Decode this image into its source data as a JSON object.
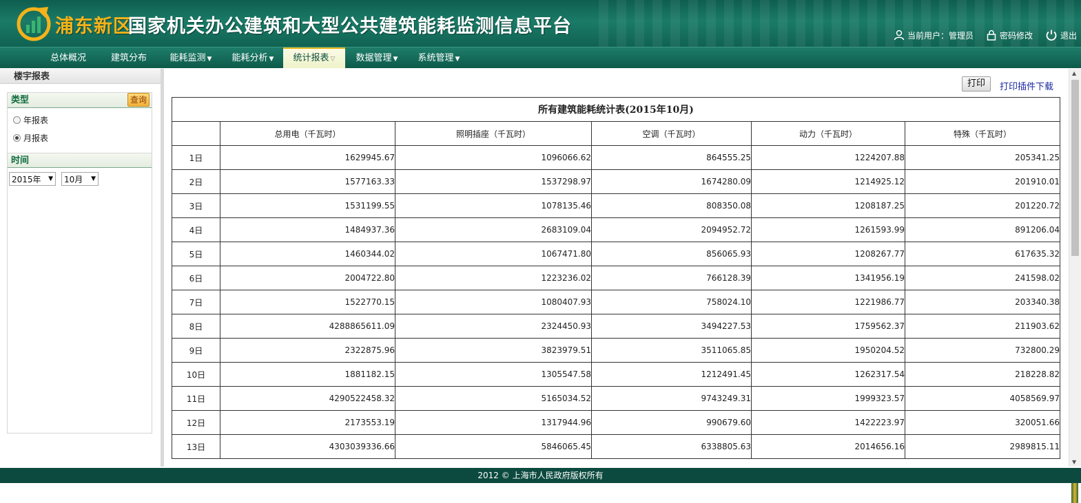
{
  "header": {
    "brand": "浦东新区",
    "title": "国家机关办公建筑和大型公共建筑能耗监测信息平台",
    "current_user_label": "当前用户：管理员",
    "change_password": "密码修改",
    "logout": "退出"
  },
  "nav": [
    {
      "label": "总体概况",
      "dropdown": false
    },
    {
      "label": "建筑分布",
      "dropdown": false
    },
    {
      "label": "能耗监测",
      "dropdown": true
    },
    {
      "label": "能耗分析",
      "dropdown": true
    },
    {
      "label": "统计报表",
      "dropdown": true,
      "active": true
    },
    {
      "label": "数据管理",
      "dropdown": true
    },
    {
      "label": "系统管理",
      "dropdown": true
    }
  ],
  "sidebar": {
    "title": "楼宇报表",
    "type_heading": "类型",
    "query_label": "查询",
    "options": [
      {
        "label": "年报表",
        "selected": false
      },
      {
        "label": "月报表",
        "selected": true
      }
    ],
    "time_heading": "时间",
    "year_value": "2015年",
    "month_value": "10月"
  },
  "content": {
    "print_label": "打印",
    "plugin_link": "打印插件下载",
    "table": {
      "caption": "所有建筑能耗统计表(2015年10月)",
      "columns": [
        "",
        "总用电（千瓦时）",
        "照明插座（千瓦时）",
        "空调（千瓦时）",
        "动力（千瓦时）",
        "特殊（千瓦时）"
      ],
      "rows": [
        [
          "1日",
          "1629945.67",
          "1096066.62",
          "864555.25",
          "1224207.88",
          "205341.25"
        ],
        [
          "2日",
          "1577163.33",
          "1537298.97",
          "1674280.09",
          "1214925.12",
          "201910.01"
        ],
        [
          "3日",
          "1531199.55",
          "1078135.46",
          "808350.08",
          "1208187.25",
          "201220.72"
        ],
        [
          "4日",
          "1484937.36",
          "2683109.04",
          "2094952.72",
          "1261593.99",
          "891206.04"
        ],
        [
          "5日",
          "1460344.02",
          "1067471.80",
          "856065.93",
          "1208267.77",
          "617635.32"
        ],
        [
          "6日",
          "2004722.80",
          "1223236.02",
          "766128.39",
          "1341956.19",
          "241598.02"
        ],
        [
          "7日",
          "1522770.15",
          "1080407.93",
          "758024.10",
          "1221986.77",
          "203340.38"
        ],
        [
          "8日",
          "4288865611.09",
          "2324450.93",
          "3494227.53",
          "1759562.37",
          "211903.62"
        ],
        [
          "9日",
          "2322875.96",
          "3823979.51",
          "3511065.85",
          "1950204.52",
          "732800.29"
        ],
        [
          "10日",
          "1881182.15",
          "1305547.58",
          "1212491.45",
          "1262317.54",
          "218228.82"
        ],
        [
          "11日",
          "4290522458.32",
          "5165034.52",
          "9743249.31",
          "1999323.57",
          "4058569.97"
        ],
        [
          "12日",
          "2173553.19",
          "1317944.96",
          "990679.60",
          "1422223.97",
          "320051.66"
        ],
        [
          "13日",
          "4303039336.66",
          "5846065.45",
          "6338805.63",
          "2014656.16",
          "2989815.11"
        ]
      ]
    }
  },
  "footer": {
    "copyright": "2012 © 上海市人民政府版权所有"
  }
}
